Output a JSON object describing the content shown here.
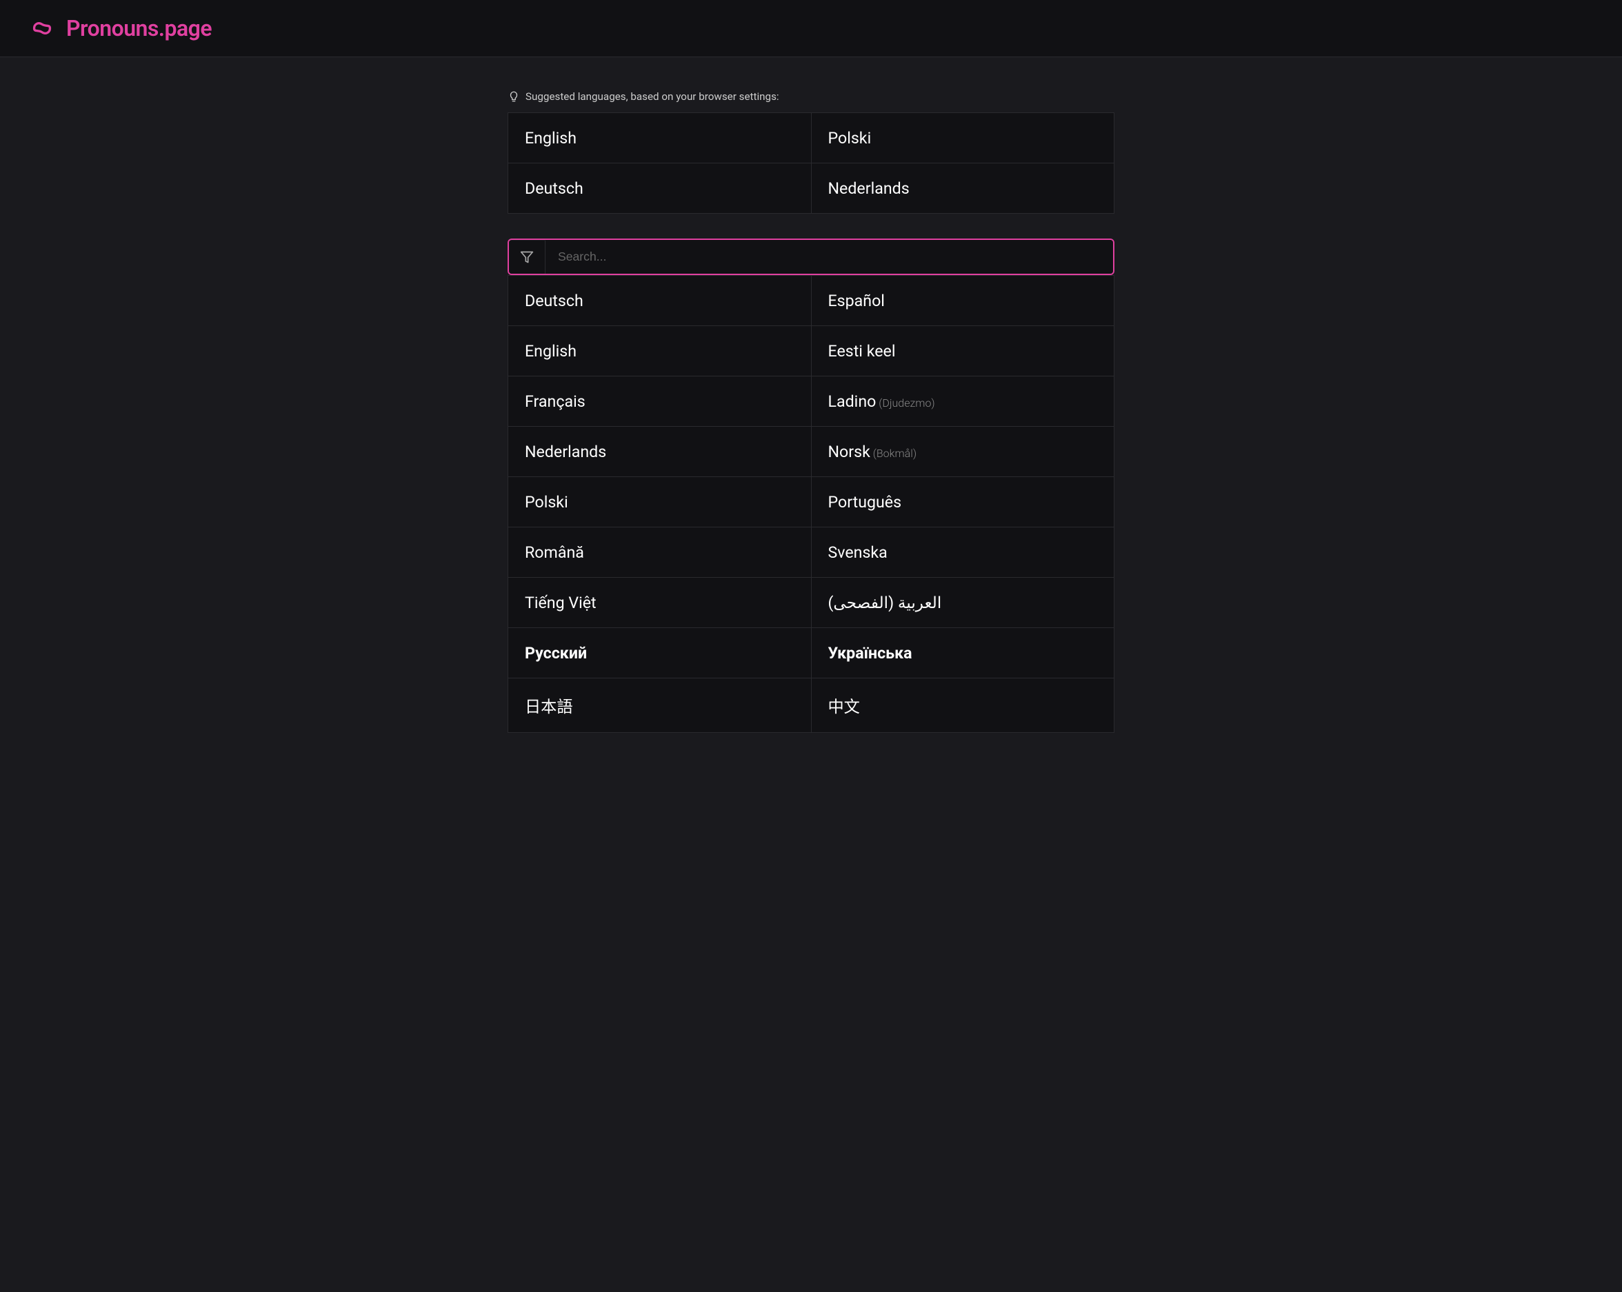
{
  "header": {
    "title": "Pronouns.page",
    "logo_alt": "pronouns-logo"
  },
  "suggestion_section": {
    "label": "Suggested languages, based on your browser settings:",
    "languages": [
      {
        "name": "English",
        "col": 0
      },
      {
        "name": "Polski",
        "col": 1
      },
      {
        "name": "Deutsch",
        "col": 0
      },
      {
        "name": "Nederlands",
        "col": 1
      }
    ]
  },
  "search": {
    "placeholder": "Search..."
  },
  "all_languages": [
    {
      "left": {
        "name": "Deutsch",
        "sub": ""
      },
      "right": {
        "name": "Español",
        "sub": ""
      }
    },
    {
      "left": {
        "name": "English",
        "sub": ""
      },
      "right": {
        "name": "Eesti keel",
        "sub": ""
      }
    },
    {
      "left": {
        "name": "Français",
        "sub": ""
      },
      "right": {
        "name": "Ladino",
        "sub": "(Djudezmo)"
      }
    },
    {
      "left": {
        "name": "Nederlands",
        "sub": ""
      },
      "right": {
        "name": "Norsk",
        "sub": "(Bokmål)"
      }
    },
    {
      "left": {
        "name": "Polski",
        "sub": ""
      },
      "right": {
        "name": "Português",
        "sub": ""
      }
    },
    {
      "left": {
        "name": "Română",
        "sub": ""
      },
      "right": {
        "name": "Svenska",
        "sub": ""
      }
    },
    {
      "left": {
        "name": "Tiếng Việt",
        "sub": ""
      },
      "right": {
        "name": "العربية (الفصحى)",
        "sub": ""
      }
    },
    {
      "left": {
        "name": "Русский",
        "sub": "",
        "bold": true
      },
      "right": {
        "name": "Українська",
        "sub": "",
        "bold": true
      }
    },
    {
      "left": {
        "name": "日本語",
        "sub": ""
      },
      "right": {
        "name": "中文",
        "sub": ""
      }
    }
  ]
}
